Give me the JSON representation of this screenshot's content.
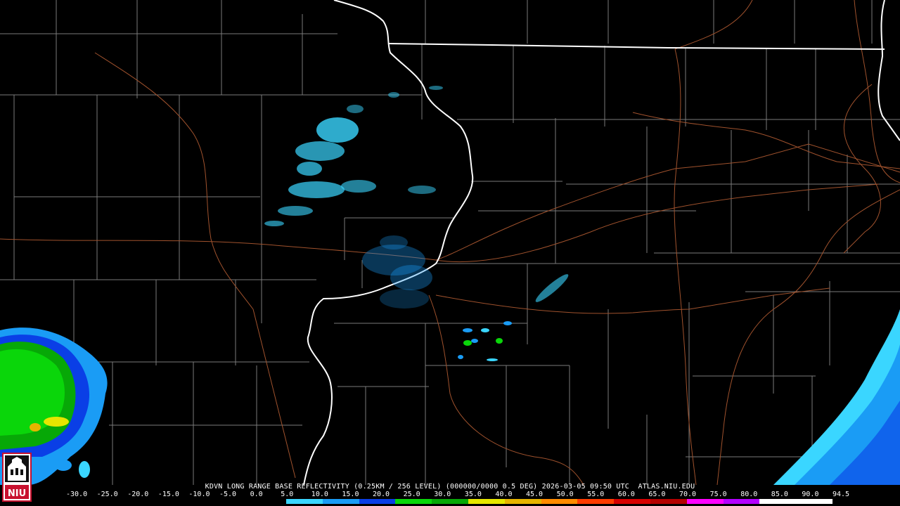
{
  "product": {
    "title": "KDVN LONG RANGE BASE REFLECTIVITY (0.25KM / 256 LEVEL) (000000/0000 0.5 DEG) 2026-03-05 09:50 UTC  ATLAS.NIU.EDU"
  },
  "logo": {
    "text": "NIU",
    "icon": "niu-seal-icon",
    "color": "#c8102e"
  },
  "colorbar": {
    "labels": [
      "-30.0",
      "-25.0",
      "-20.0",
      "-15.0",
      "-10.0",
      "-5.0",
      "0.0",
      "5.0",
      "10.0",
      "15.0",
      "20.0",
      "25.0",
      "30.0",
      "35.0",
      "40.0",
      "45.0",
      "50.0",
      "55.0",
      "60.0",
      "65.0",
      "70.0",
      "75.0",
      "80.0",
      "85.0",
      "90.0",
      "94.5"
    ],
    "colors": [
      "#000000",
      "#000000",
      "#000000",
      "#000000",
      "#000000",
      "#000000",
      "#3ad6ff",
      "#1a9cf5",
      "#0a3fe6",
      "#0ad60a",
      "#07a807",
      "#e6e600",
      "#e6b400",
      "#ff8c00",
      "#ff3c00",
      "#d60000",
      "#b40000",
      "#ff00ff",
      "#b400ff",
      "#ffffff",
      "#ffffff"
    ]
  },
  "map": {
    "background": "#000000",
    "county_color": "#7a7a7a",
    "state_color": "#ffffff",
    "highway_color": "#a0522d"
  }
}
